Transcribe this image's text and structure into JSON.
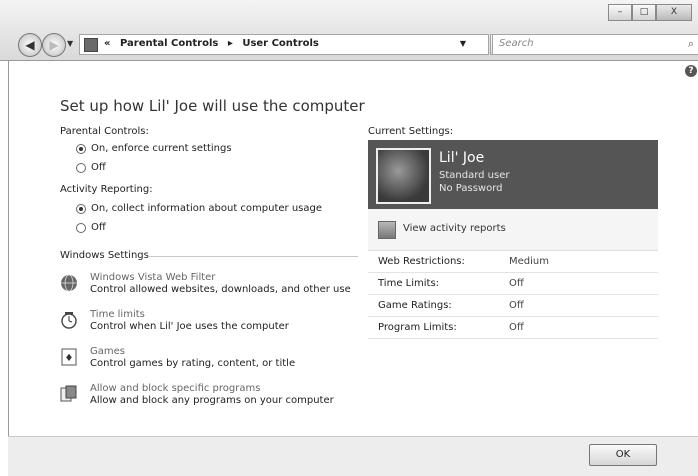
{
  "caption_buttons": {
    "minimize": "–",
    "maximize": "□",
    "close": "X"
  },
  "nav": {
    "back": "◀",
    "forward": "▶",
    "dropdown": "▼"
  },
  "address": {
    "prefix": "«",
    "crumbs": [
      "Parental Controls",
      "▸",
      "User Controls"
    ],
    "dropdown": "▼"
  },
  "refresh": "↻",
  "search": {
    "placeholder": "Search",
    "icon": "⌕"
  },
  "help_icon": "?",
  "page_title": "Set up how Lil' Joe will use the computer",
  "parental_controls": {
    "label": "Parental Controls:",
    "options": [
      {
        "label": "On, enforce current settings",
        "selected": true
      },
      {
        "label": "Off",
        "selected": false
      }
    ]
  },
  "activity_reporting": {
    "label": "Activity Reporting:",
    "options": [
      {
        "label": "On, collect information about computer usage",
        "selected": true
      },
      {
        "label": "Off",
        "selected": false
      }
    ]
  },
  "windows_settings": {
    "label": "Windows Settings",
    "items": [
      {
        "title": "Windows Vista Web Filter",
        "desc": "Control allowed websites, downloads, and other use",
        "icon": "globe-icon"
      },
      {
        "title": "Time limits",
        "desc": "Control when Lil' Joe uses the computer",
        "icon": "clock-icon"
      },
      {
        "title": "Games",
        "desc": "Control games by rating, content, or title",
        "icon": "games-icon"
      },
      {
        "title": "Allow and block specific programs",
        "desc": "Allow and block any programs on your computer",
        "icon": "programs-icon"
      }
    ]
  },
  "current_settings": {
    "label": "Current Settings:",
    "user": {
      "name": "Lil' Joe",
      "role": "Standard user",
      "password": "No Password"
    },
    "view_reports": "View activity reports",
    "rows": [
      {
        "key": "Web Restrictions:",
        "value": "Medium"
      },
      {
        "key": "Time Limits:",
        "value": "Off"
      },
      {
        "key": "Game Ratings:",
        "value": "Off"
      },
      {
        "key": "Program Limits:",
        "value": "Off"
      }
    ]
  },
  "footer": {
    "ok_label": "OK"
  }
}
